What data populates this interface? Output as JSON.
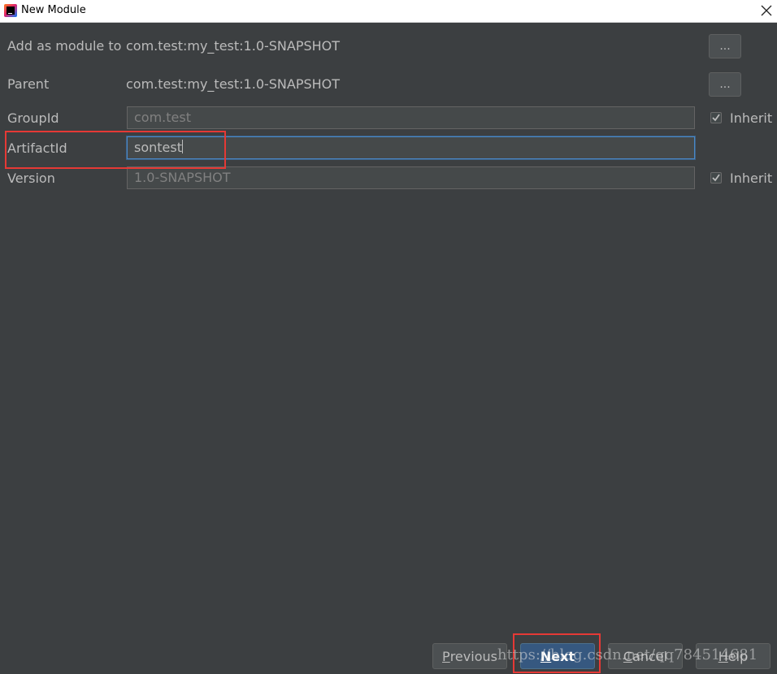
{
  "window": {
    "title": "New Module",
    "icon": "intellij-idea-icon",
    "close_glyph": "✕"
  },
  "form": {
    "add_as_module": {
      "label": "Add as module to",
      "value": "com.test:my_test:1.0-SNAPSHOT",
      "button_label": "..."
    },
    "parent": {
      "label": "Parent",
      "value": "com.test:my_test:1.0-SNAPSHOT",
      "button_label": "..."
    },
    "group_id": {
      "label": "GroupId",
      "value": "com.test",
      "inherit_label": "Inherit",
      "inherit_checked": true
    },
    "artifact_id": {
      "label": "ArtifactId",
      "value": "sontest"
    },
    "version": {
      "label": "Version",
      "value": "1.0-SNAPSHOT",
      "inherit_label": "Inherit",
      "inherit_checked": true
    }
  },
  "buttons": {
    "previous": {
      "mnemonic": "P",
      "rest": "revious"
    },
    "next": {
      "mnemonic": "N",
      "rest": "ext"
    },
    "cancel": {
      "mnemonic": "C",
      "rest": "ancel"
    },
    "help": {
      "mnemonic": "H",
      "rest": "elp"
    }
  },
  "watermark": "https://blog.csdn.net/qq784514681",
  "colors": {
    "background": "#3c3f41",
    "field_bg": "#45494a",
    "focus_border": "#4a88c7",
    "default_button": "#365880",
    "annotation": "#e53935"
  }
}
